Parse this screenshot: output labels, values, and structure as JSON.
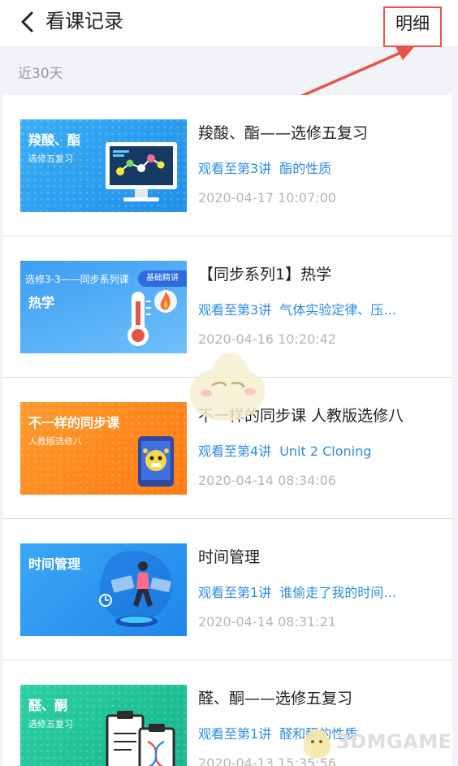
{
  "header": {
    "title": "看课记录",
    "detail_label": "明细"
  },
  "section": {
    "label": "近30天"
  },
  "records": [
    {
      "thumb": {
        "title": "羧酸、酯",
        "sub": "选修五复习",
        "badge": "",
        "art": "monitor-molecule-icon",
        "color": "#2ea3f2"
      },
      "title": "羧酸、酯——选修五复习",
      "progress_lecture": "观看至第3讲",
      "progress_topic": "酯的性质",
      "time": "2020-04-17 10:07:00"
    },
    {
      "thumb": {
        "title": "热学",
        "sub": "",
        "heading": "选修3-3——同步系列课",
        "badge": "基础精讲",
        "art": "thermometer-fire-icon",
        "color": "#3e9ff5"
      },
      "title": "【同步系列1】热学",
      "progress_lecture": "观看至第3讲",
      "progress_topic": "气体实验定律、压…",
      "time": "2020-04-16 10:20:42"
    },
    {
      "thumb": {
        "title": "不一样的同步课",
        "sub": "人教版选修八",
        "badge": "",
        "art": "tablet-mascot-icon",
        "color": "#ff8a1e"
      },
      "title": "不一样的同步课 人教版选修八",
      "progress_lecture": "观看至第4讲",
      "progress_topic": "Unit 2 Cloning",
      "time": "2020-04-14 08:34:06"
    },
    {
      "thumb": {
        "title": "时间管理",
        "sub": "",
        "badge": "",
        "art": "time-figure-icon",
        "color": "#2d9af0"
      },
      "title": "时间管理",
      "progress_lecture": "观看至第1讲",
      "progress_topic": "谁偷走了我的时间…",
      "time": "2020-04-14 08:31:21"
    },
    {
      "thumb": {
        "title": "醛、酮",
        "sub": "选修五复习",
        "badge": "",
        "art": "clipboard-dna-icon",
        "color": "#22c29b"
      },
      "title": "醛、酮——选修五复习",
      "progress_lecture": "观看至第1讲",
      "progress_topic": "醛和酮的性质",
      "time": "2020-04-13 15:35:56"
    }
  ],
  "watermark": {
    "text": "3DMGAME"
  },
  "colors": {
    "accent_blue": "#2f8ce0",
    "annotation_red": "#e8554b",
    "time_gray": "#b5b5b5"
  }
}
